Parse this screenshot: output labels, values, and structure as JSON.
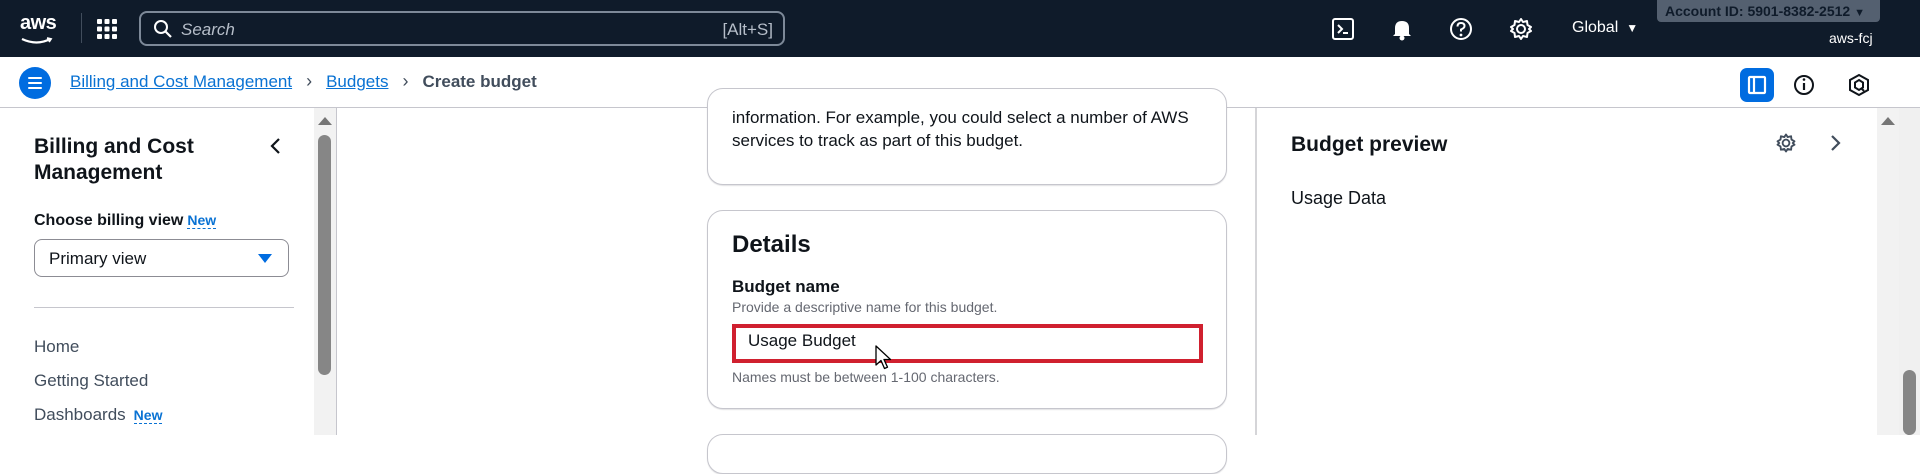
{
  "topnav": {
    "logo_text": "aws",
    "search_placeholder": "Search",
    "search_shortcut": "[Alt+S]",
    "region": "Global",
    "account_id": "Account ID: 5901-8382-2512",
    "user": "aws-fcj",
    "icons": [
      "cloudshell-icon",
      "bell-icon",
      "help-icon",
      "settings-icon"
    ]
  },
  "breadcrumb": {
    "items": [
      "Billing and Cost Management",
      "Budgets"
    ],
    "current": "Create budget"
  },
  "sidebar": {
    "title": "Billing and Cost Management",
    "billing_view_label": "Choose billing view",
    "new_badge": "New",
    "billing_view_value": "Primary view",
    "nav_items": [
      "Home",
      "Getting Started",
      "Dashboards"
    ],
    "dashboards_badge": "New"
  },
  "main": {
    "prev_card_text": "information. For example, you could select a number of AWS services to track as part of this budget.",
    "details": {
      "heading": "Details",
      "budget_name_label": "Budget name",
      "budget_name_desc": "Provide a descriptive name for this budget.",
      "budget_name_value": "Usage Budget",
      "budget_name_hint": "Names must be between 1-100 characters."
    }
  },
  "preview": {
    "title": "Budget preview",
    "subtitle": "Usage Data"
  },
  "colors": {
    "nav_bg": "#0f1b2a",
    "link": "#0972d3",
    "highlight_border": "#d0202f",
    "accent_blue": "#006ce0"
  }
}
